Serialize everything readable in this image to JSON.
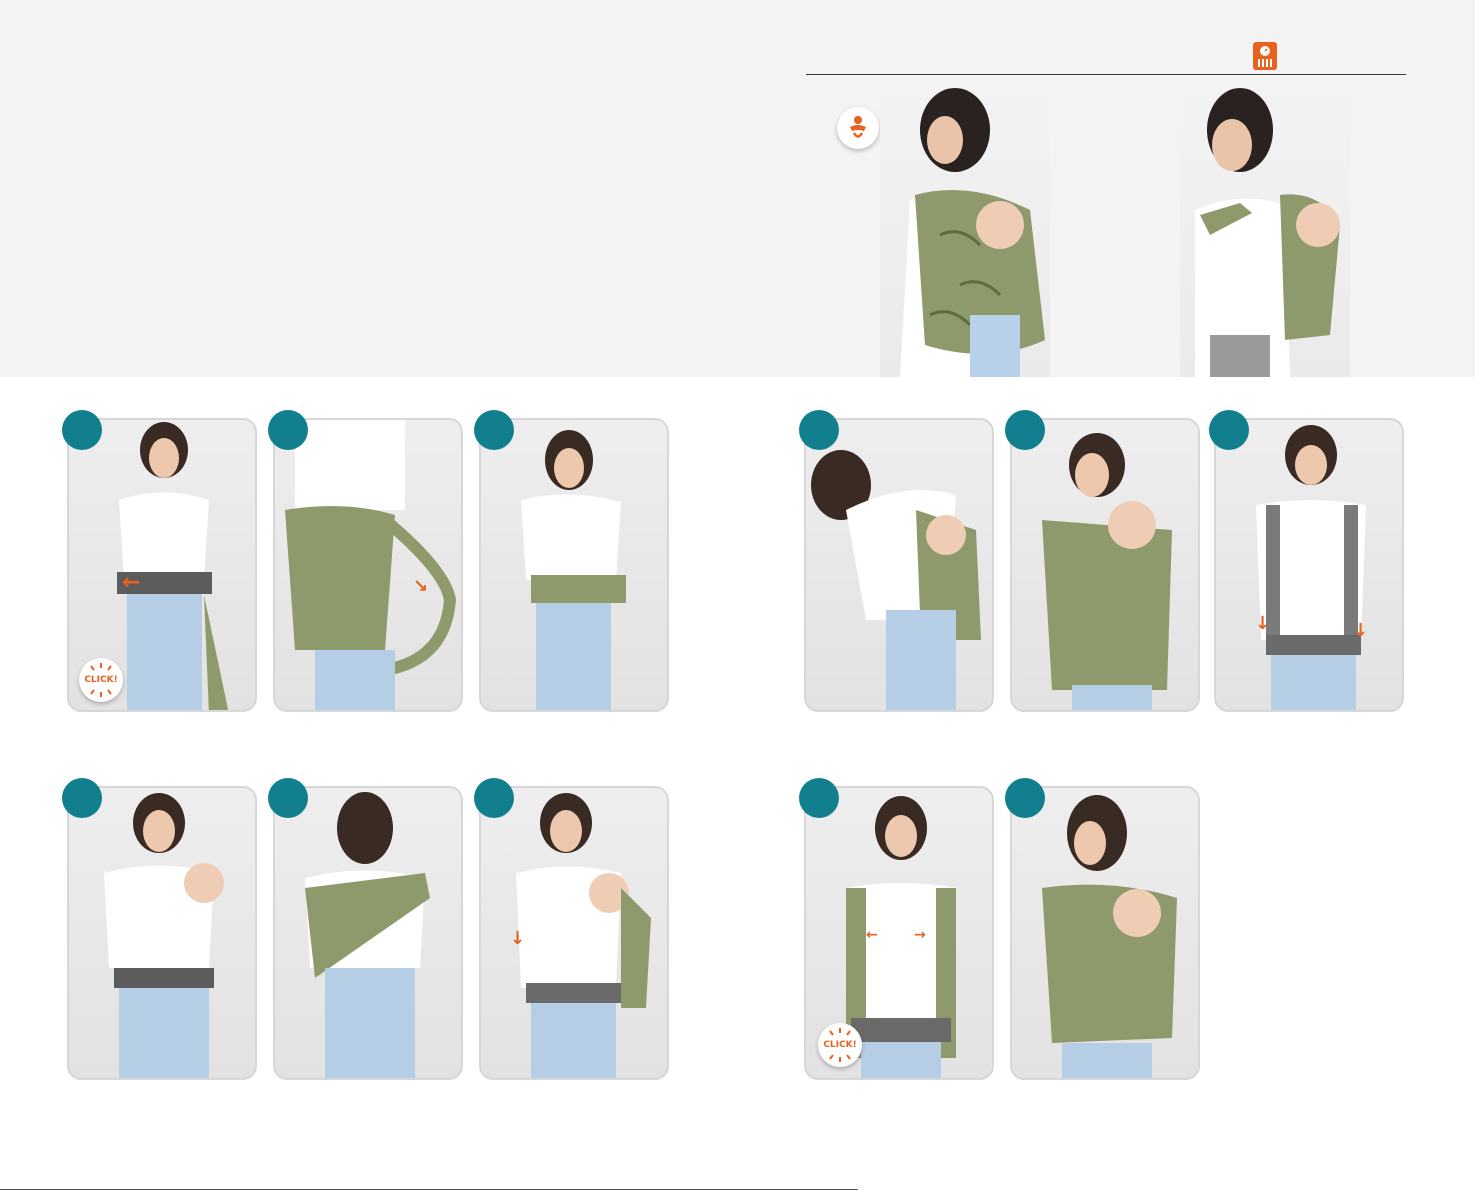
{
  "click_label": "CLICK!",
  "footer_text": "",
  "colors": {
    "accent": "#e8611f",
    "step_circle": "#127f8f",
    "band": "#f3f3f3"
  },
  "icons": {
    "weight": "scale-icon",
    "baby": "baby-icon"
  }
}
